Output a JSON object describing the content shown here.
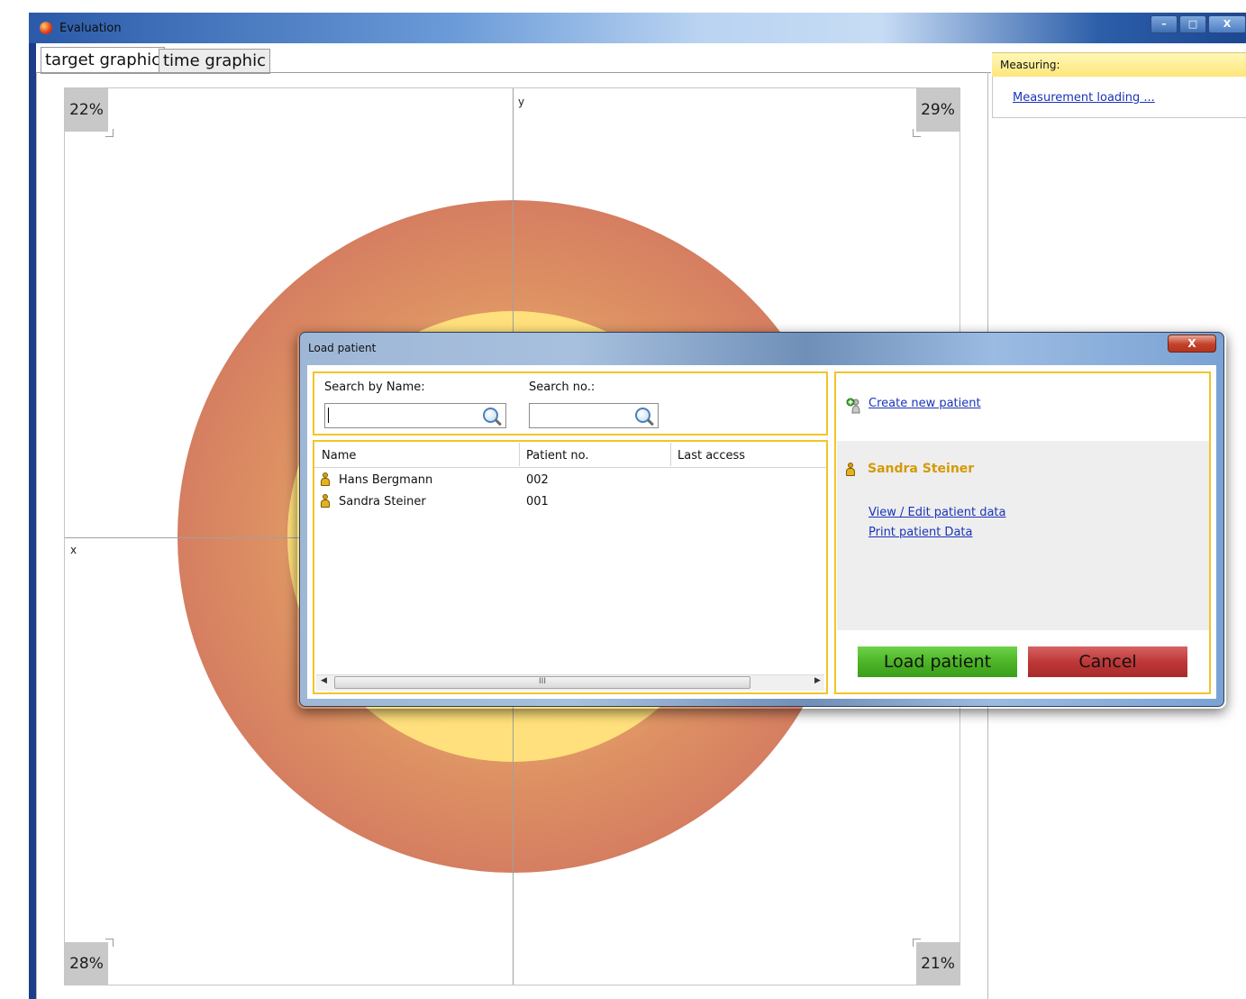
{
  "window": {
    "title": "Evaluation",
    "minimize": "–",
    "maximize": "□",
    "close": "X"
  },
  "tabs": [
    {
      "label": "target graphic",
      "active": true
    },
    {
      "label": "time graphic",
      "active": false
    }
  ],
  "target": {
    "axis_y": "y",
    "axis_x": "x",
    "quadrants": {
      "top_left": "22%",
      "top_right": "29%",
      "bottom_left": "28%",
      "bottom_right": "21%"
    }
  },
  "measuring": {
    "header": "Measuring:",
    "link": "Measurement loading ..."
  },
  "dialog": {
    "title": "Load patient",
    "close": "X",
    "search_name_label": "Search by Name:",
    "search_no_label": "Search no.:",
    "search_name_value": "",
    "search_no_value": "",
    "columns": [
      "Name",
      "Patient no.",
      "Last access"
    ],
    "patients": [
      {
        "name": "Hans Bergmann",
        "no": "002",
        "last_access": ""
      },
      {
        "name": "Sandra Steiner",
        "no": "001",
        "last_access": ""
      }
    ],
    "scroll_thumb_grip": "III",
    "create_link": "Create new patient",
    "selected_patient": "Sandra Steiner",
    "view_edit_link": "View / Edit patient data",
    "print_link": "Print patient Data",
    "load_button": "Load patient",
    "cancel_button": "Cancel"
  },
  "colors": {
    "accent_gold": "#f2c428",
    "load_green": "#4db526",
    "cancel_red": "#bf3838",
    "link_blue": "#1a33b8"
  }
}
